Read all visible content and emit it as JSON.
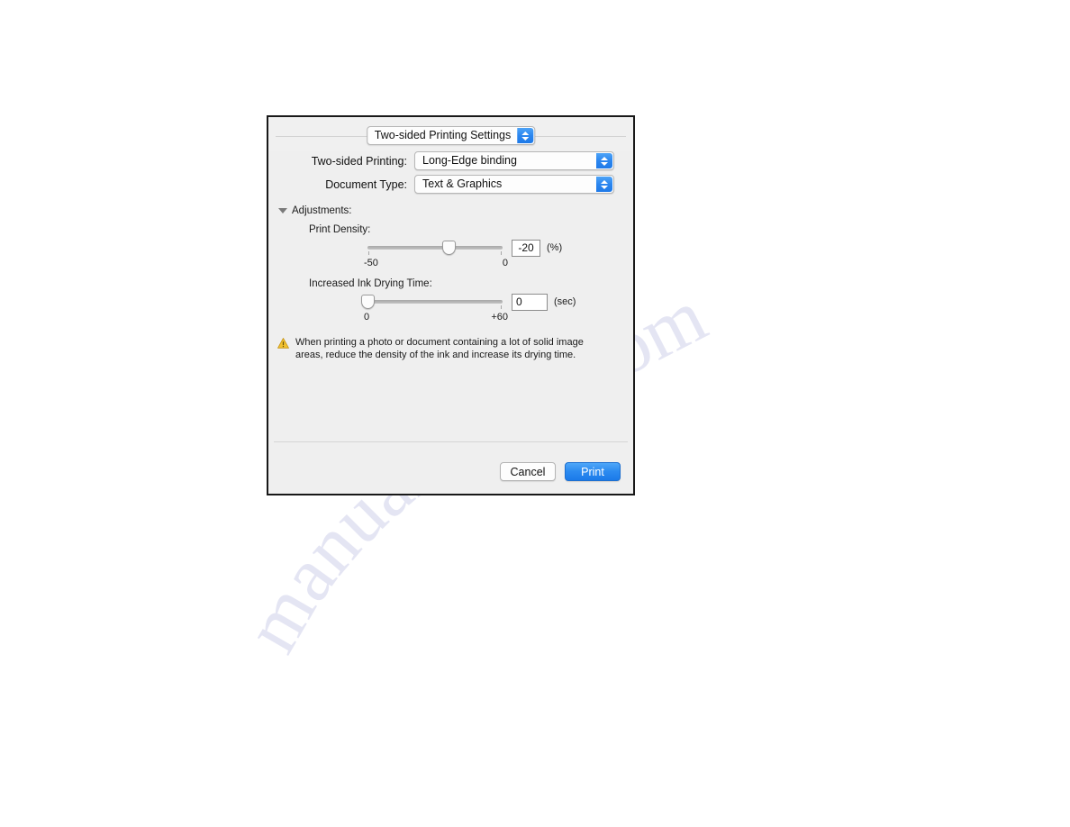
{
  "page": {
    "watermark_text": "manualshive.com"
  },
  "dialog": {
    "pane_popup": {
      "label": "Two-sided Printing Settings",
      "icon": "stepper-updown-icon"
    },
    "rows": [
      {
        "label": "Two-sided Printing:",
        "value": "Long-Edge binding",
        "name": "two-sided-printing"
      },
      {
        "label": "Document Type:",
        "value": "Text & Graphics",
        "name": "document-type"
      }
    ],
    "adjustments": {
      "disclosure_label": "Adjustments:",
      "disclosure_icon": "triangle-down-icon",
      "expanded": true,
      "print_density": {
        "caption": "Print Density:",
        "value": "-20",
        "unit": "(%)",
        "min_label": "-50",
        "max_label": "0",
        "min": -50,
        "max": 0,
        "percent": 60
      },
      "ink_drying_time": {
        "caption": "Increased Ink Drying Time:",
        "value": "0",
        "unit": "(sec)",
        "min_label": "0",
        "max_label": "+60",
        "min": 0,
        "max": 60,
        "percent": 0
      }
    },
    "warning": {
      "icon": "warning-triangle-icon",
      "text": "When printing a photo or document containing a lot of solid image areas, reduce the density of the ink and increase its drying time."
    },
    "footer": {
      "cancel_label": "Cancel",
      "print_label": "Print",
      "accent_color": "#2c8bf0"
    }
  }
}
